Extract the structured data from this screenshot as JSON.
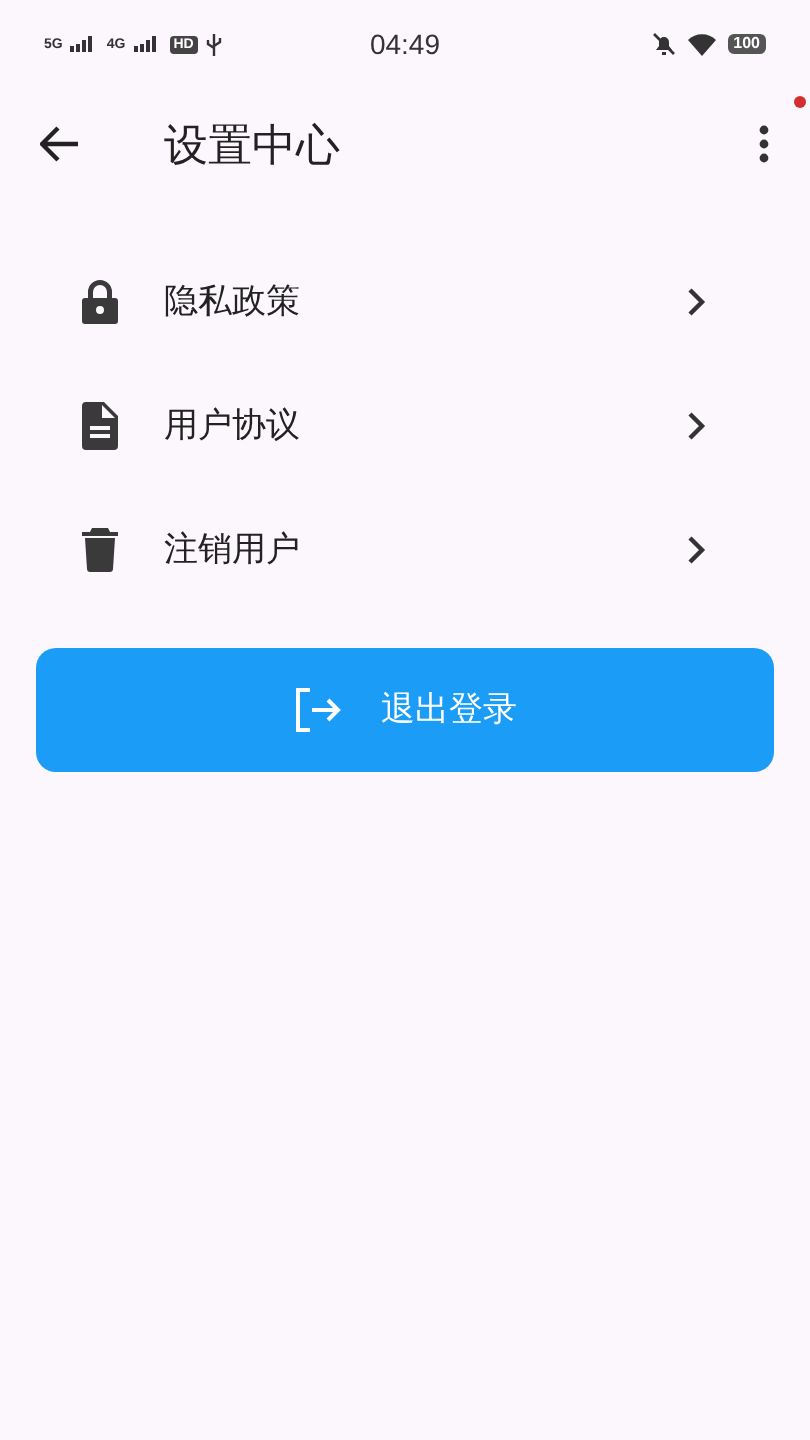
{
  "status_bar": {
    "network_1": "5G",
    "network_2": "4G",
    "hd": "HD",
    "time": "04:49",
    "battery": "100"
  },
  "app_bar": {
    "title": "设置中心"
  },
  "menu": [
    {
      "kind": "lock",
      "label": "隐私政策"
    },
    {
      "kind": "document",
      "label": "用户协议"
    },
    {
      "kind": "trash",
      "label": "注销用户"
    }
  ],
  "logout_button": {
    "label": "退出登录"
  }
}
